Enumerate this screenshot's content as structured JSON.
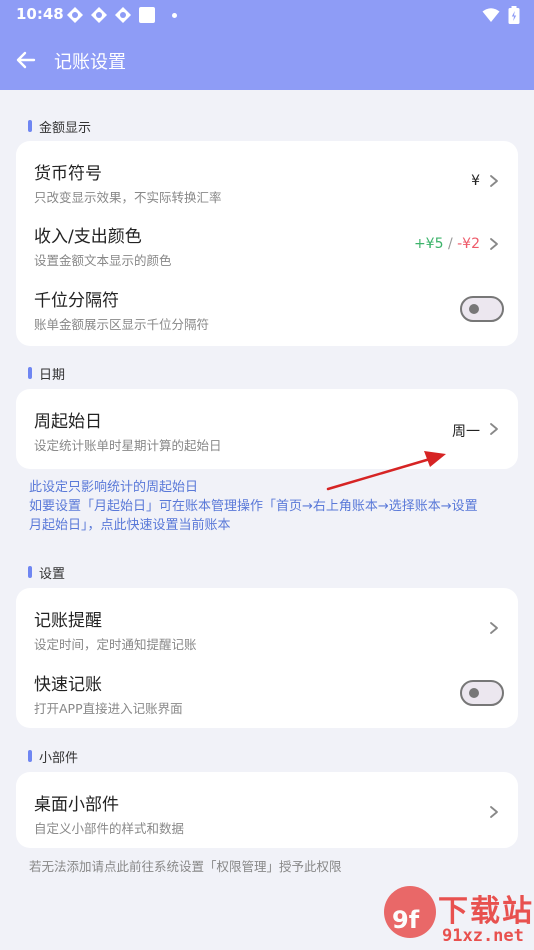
{
  "status": {
    "time": "10:48"
  },
  "appbar": {
    "title": "记账设置"
  },
  "sections": {
    "amount": "金额显示",
    "date": "日期",
    "settings": "设置",
    "widgets": "小部件"
  },
  "amount": {
    "currency": {
      "title": "货币符号",
      "subtitle": "只改变显示效果，不实际转换汇率",
      "value": "¥"
    },
    "colors": {
      "title": "收入/支出颜色",
      "subtitle": "设置金额文本显示的颜色",
      "income": "+¥5",
      "separator": "/",
      "expense": "-¥2"
    },
    "thousands": {
      "title": "千位分隔符",
      "subtitle": "账单金额展示区显示千位分隔符",
      "enabled": false
    }
  },
  "date": {
    "week_start": {
      "title": "周起始日",
      "subtitle": "设定统计账单时星期计算的起始日",
      "value": "周一"
    }
  },
  "note": {
    "line1": "此设定只影响统计的周起始日",
    "line2": "如要设置「月起始日」可在账本管理操作「首页→右上角账本→选择账本→设置",
    "line3": "月起始日」，点此快速设置当前账本"
  },
  "settings": {
    "reminder": {
      "title": "记账提醒",
      "subtitle": "设定时间，定时通知提醒记账"
    },
    "quick": {
      "title": "快速记账",
      "subtitle": "打开APP直接进入记账界面",
      "enabled": false
    }
  },
  "widgets": {
    "desktop": {
      "title": "桌面小部件",
      "subtitle": "自定义小部件的样式和数据"
    }
  },
  "footer": "若无法添加请点此前往系统设置「权限管理」授予此权限",
  "watermark": {
    "title": "下载站",
    "url": "91xz.net",
    "logo": "9f"
  },
  "colors": {
    "primary": "#8e9cf6",
    "accent": "#6f86f2",
    "income": "#3cb36a",
    "expense": "#ee5a69",
    "link": "#5a79d8"
  }
}
